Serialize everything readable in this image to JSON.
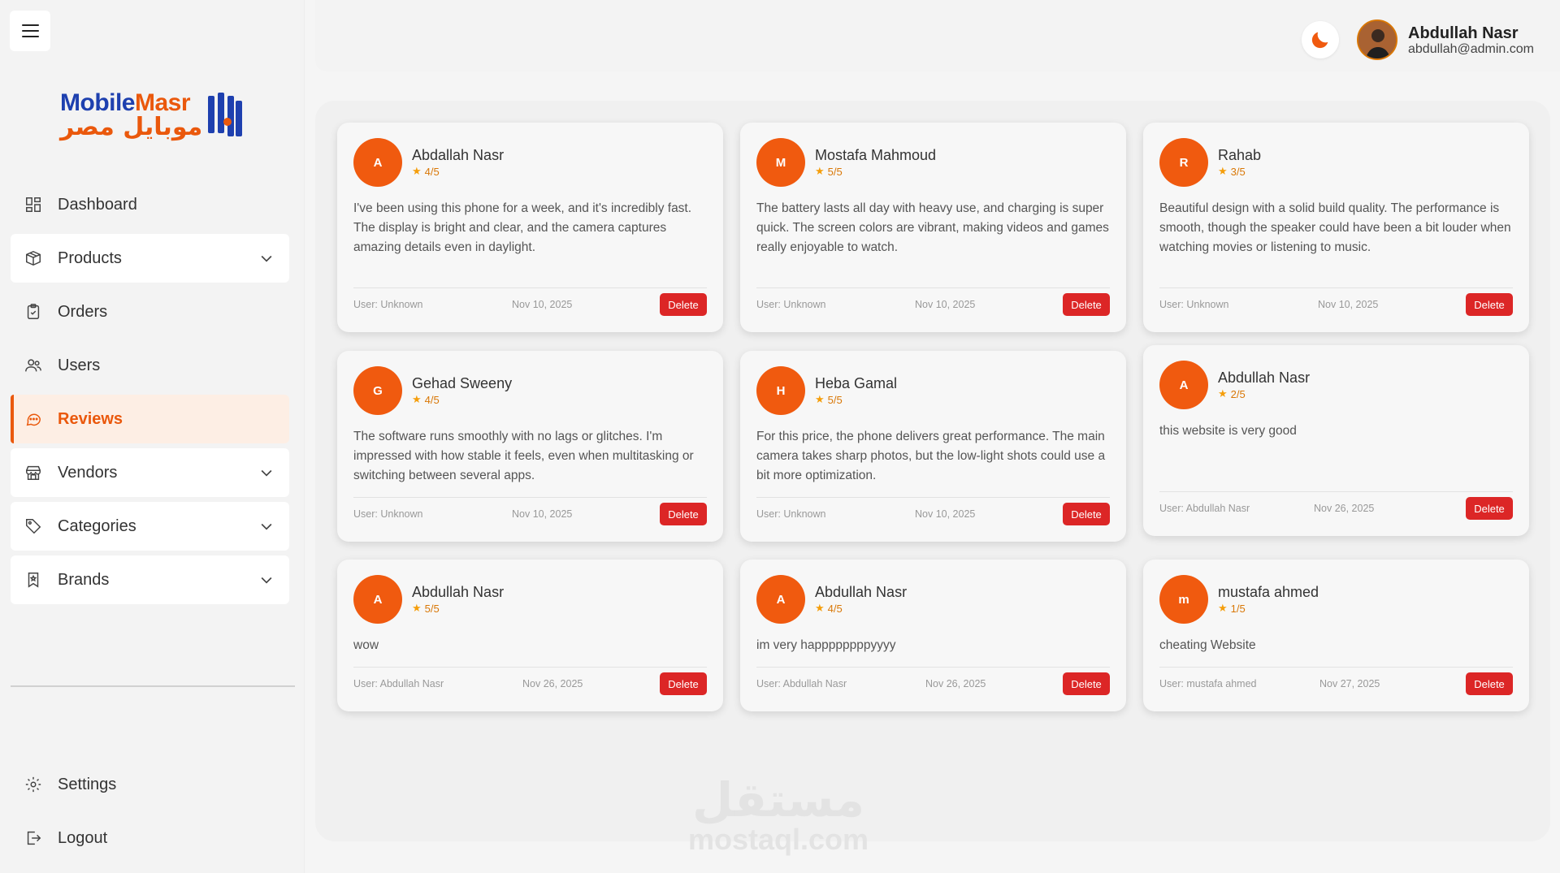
{
  "brand": {
    "name_part1": "Mobile",
    "name_part2": "Masr",
    "name_ar": "موبايل مصر",
    "primary_color": "#1e40af",
    "accent_color": "#ea580c"
  },
  "sidebar": {
    "items": [
      {
        "label": "Dashboard",
        "icon": "dashboard-icon"
      },
      {
        "label": "Products",
        "icon": "box-icon"
      },
      {
        "label": "Orders",
        "icon": "clipboard-icon"
      },
      {
        "label": "Users",
        "icon": "users-icon"
      },
      {
        "label": "Reviews",
        "icon": "chat-icon"
      },
      {
        "label": "Vendors",
        "icon": "store-icon"
      },
      {
        "label": "Categories",
        "icon": "tag-icon"
      },
      {
        "label": "Brands",
        "icon": "bookmark-icon"
      }
    ],
    "bottom": [
      {
        "label": "Settings",
        "icon": "gear-icon"
      },
      {
        "label": "Logout",
        "icon": "logout-icon"
      }
    ]
  },
  "header": {
    "user_name": "Abdullah Nasr",
    "user_email": "abdullah@admin.com"
  },
  "reviews": [
    {
      "initial": "A",
      "name": "Abdallah Nasr",
      "rating": "4/5",
      "text": "I've been using this phone for a week, and it's incredibly fast. The display is bright and clear, and the camera captures amazing details even in daylight.",
      "user": "User: Unknown",
      "date": "Nov 10, 2025"
    },
    {
      "initial": "M",
      "name": "Mostafa Mahmoud",
      "rating": "5/5",
      "text": "The battery lasts all day with heavy use, and charging is super quick. The screen colors are vibrant, making videos and games really enjoyable to watch.",
      "user": "User: Unknown",
      "date": "Nov 10, 2025"
    },
    {
      "initial": "R",
      "name": "Rahab",
      "rating": "3/5",
      "text": "Beautiful design with a solid build quality. The performance is smooth, though the speaker could have been a bit louder when watching movies or listening to music.",
      "user": "User: Unknown",
      "date": "Nov 10, 2025"
    },
    {
      "initial": "G",
      "name": "Gehad Sweeny",
      "rating": "4/5",
      "text": "The software runs smoothly with no lags or glitches. I'm impressed with how stable it feels, even when multitasking or switching between several apps.",
      "user": "User: Unknown",
      "date": "Nov 10, 2025"
    },
    {
      "initial": "H",
      "name": "Heba Gamal",
      "rating": "5/5",
      "text": "For this price, the phone delivers great performance. The main camera takes sharp photos, but the low-light shots could use a bit more optimization.",
      "user": "User: Unknown",
      "date": "Nov 10, 2025"
    },
    {
      "initial": "A",
      "name": "Abdullah Nasr",
      "rating": "2/5",
      "text": "this website is very good",
      "user": "User: Abdullah Nasr",
      "date": "Nov 26, 2025"
    },
    {
      "initial": "A",
      "name": "Abdullah Nasr",
      "rating": "5/5",
      "text": "wow",
      "user": "User: Abdullah Nasr",
      "date": "Nov 26, 2025"
    },
    {
      "initial": "A",
      "name": "Abdullah Nasr",
      "rating": "4/5",
      "text": "im very happppppppyyyy",
      "user": "User: Abdullah Nasr",
      "date": "Nov 26, 2025"
    },
    {
      "initial": "m",
      "name": "mustafa ahmed",
      "rating": "1/5",
      "text": "cheating Website",
      "user": "User: mustafa ahmed",
      "date": "Nov 27, 2025"
    }
  ],
  "actions": {
    "delete_label": "Delete"
  },
  "watermark": {
    "ar": "مستقل",
    "en": "mostaql.com"
  }
}
